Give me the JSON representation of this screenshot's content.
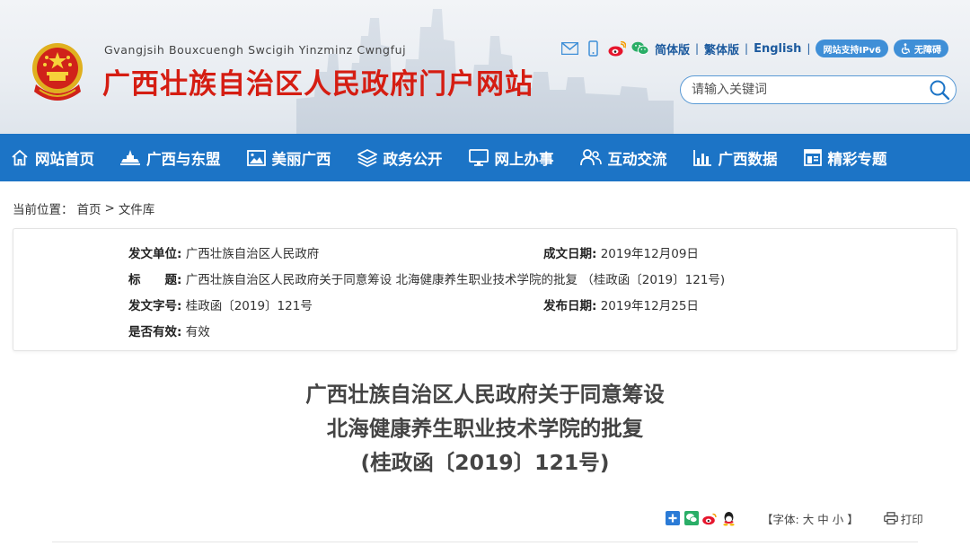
{
  "header": {
    "pinyin": "Gvangjsih Bouxcuengh Swcigih Yinzminz Cwngfuj",
    "title": "广西壮族自治区人民政府门户网站",
    "lang_simplified": "简体版",
    "lang_traditional": "繁体版",
    "lang_english": "English",
    "separator": "|",
    "ipv6_badge": "网站支持IPv6",
    "accessibility_badge": "无障碍",
    "search_placeholder": "请输入关键词"
  },
  "nav": {
    "items": [
      {
        "label": "网站首页",
        "icon": "home-icon"
      },
      {
        "label": "广西与东盟",
        "icon": "monument-icon"
      },
      {
        "label": "美丽广西",
        "icon": "picture-icon"
      },
      {
        "label": "政务公开",
        "icon": "layers-icon"
      },
      {
        "label": "网上办事",
        "icon": "monitor-icon"
      },
      {
        "label": "互动交流",
        "icon": "users-icon"
      },
      {
        "label": "广西数据",
        "icon": "bar-chart-icon"
      },
      {
        "label": "精彩专题",
        "icon": "topic-icon"
      }
    ]
  },
  "breadcrumb": {
    "prefix": "当前位置：",
    "home": "首页",
    "arrow": ">",
    "current": "文件库"
  },
  "info": {
    "issuer_label": "发文单位:",
    "issuer_value": "广西壮族自治区人民政府",
    "date_created_label": "成文日期:",
    "date_created_value": "2019年12月09日",
    "title_label": "标　　题:",
    "title_value": "广西壮族自治区人民政府关于同意筹设 北海健康养生职业技术学院的批复 （桂政函〔2019〕121号)",
    "doc_number_label": "发文字号:",
    "doc_number_value": "桂政函〔2019〕121号",
    "publish_date_label": "发布日期:",
    "publish_date_value": "2019年12月25日",
    "validity_label": "是否有效:",
    "validity_value": "有效"
  },
  "article": {
    "title_line1": "广西壮族自治区人民政府关于同意筹设",
    "title_line2": "北海健康养生职业技术学院的批复",
    "title_line3": "(桂政函〔2019〕121号)"
  },
  "tools": {
    "font_label": "【字体:",
    "font_large": "大",
    "font_medium": "中",
    "font_small": "小",
    "font_close": "】",
    "print_label": "打印"
  },
  "colors": {
    "nav_blue": "#1c74c6",
    "title_red": "#d51d12",
    "link_blue": "#1c5a9e"
  }
}
